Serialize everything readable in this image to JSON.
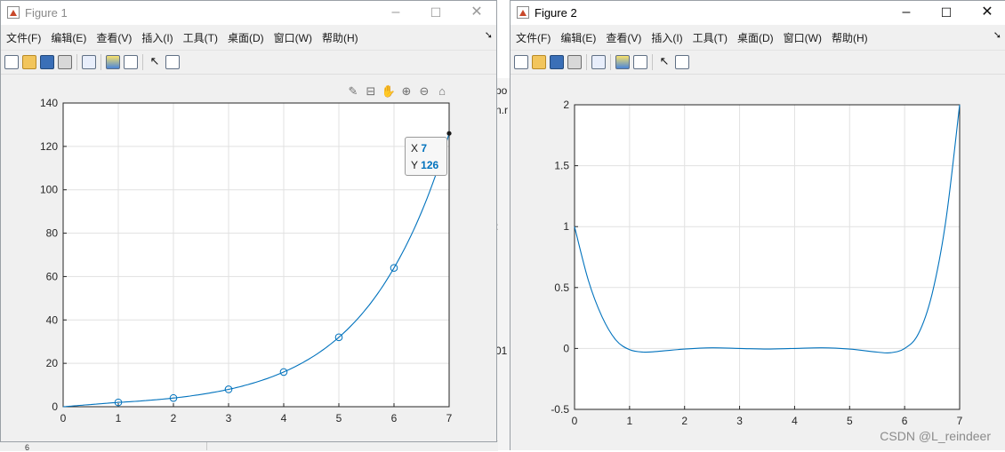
{
  "windows": [
    {
      "title": "Figure 1",
      "menu": [
        "文件(F)",
        "编辑(E)",
        "查看(V)",
        "插入(I)",
        "工具(T)",
        "桌面(D)",
        "窗口(W)",
        "帮助(H)"
      ],
      "controls": [
        "–",
        "☐",
        "✕"
      ],
      "datatip": {
        "x_label": "X",
        "x_value": "7",
        "y_label": "Y",
        "y_value": "126"
      }
    },
    {
      "title": "Figure 2",
      "menu": [
        "文件(F)",
        "编辑(E)",
        "查看(V)",
        "插入(I)",
        "工具(T)",
        "桌面(D)",
        "窗口(W)",
        "帮助(H)"
      ],
      "controls": [
        "–",
        "☐",
        "✕"
      ]
    }
  ],
  "toolbar_icons": [
    "new-figure-icon",
    "open-file-icon",
    "save-icon",
    "print-icon",
    "link-plot-icon",
    "insert-colorbar-icon",
    "insert-legend-icon",
    "edit-plot-pointer-icon",
    "property-inspector-icon"
  ],
  "axes_toolbar_icons": [
    "brush-icon",
    "datatip-icon",
    "pan-icon",
    "zoom-in-icon",
    "zoom-out-icon",
    "home-icon"
  ],
  "background": {
    "fragments": [
      "po",
      "n.r",
      ":",
      "01",
      "6"
    ]
  },
  "watermark": "CSDN @L_reindeer",
  "chart_data": [
    {
      "type": "line",
      "title": "",
      "xlabel": "",
      "ylabel": "",
      "xlim": [
        0,
        7
      ],
      "ylim": [
        0,
        140
      ],
      "xticks": [
        "0",
        "1",
        "2",
        "3",
        "4",
        "5",
        "6",
        "7"
      ],
      "yticks": [
        "0",
        "20",
        "40",
        "60",
        "80",
        "100",
        "120",
        "140"
      ],
      "grid": true,
      "line_color": "#0072bd",
      "series": [
        {
          "x": [
            0,
            1,
            2,
            3,
            4,
            5,
            6,
            7
          ],
          "y": [
            0,
            2,
            4,
            8,
            16,
            32,
            64,
            126
          ],
          "markers": [
            [
              1,
              2
            ],
            [
              2,
              4
            ],
            [
              3,
              8
            ],
            [
              4,
              16
            ],
            [
              5,
              32
            ],
            [
              6,
              64
            ]
          ]
        }
      ],
      "datatip_point": [
        7,
        126
      ]
    },
    {
      "type": "line",
      "title": "",
      "xlabel": "",
      "ylabel": "",
      "xlim": [
        0,
        7
      ],
      "ylim": [
        -0.5,
        2
      ],
      "xticks": [
        "0",
        "1",
        "2",
        "3",
        "4",
        "5",
        "6",
        "7"
      ],
      "yticks": [
        "-0.5",
        "0",
        "0.5",
        "1",
        "1.5",
        "2"
      ],
      "grid": true,
      "line_color": "#0072bd",
      "series": [
        {
          "x": [
            0,
            0.25,
            0.5,
            0.75,
            1,
            1.25,
            1.5,
            2,
            2.5,
            3,
            3.5,
            4,
            4.5,
            5,
            5.5,
            5.75,
            6,
            6.25,
            6.5,
            6.75,
            7
          ],
          "y": [
            1,
            0.56,
            0.26,
            0.07,
            -0.01,
            -0.03,
            -0.025,
            -0.005,
            0.005,
            0,
            -0.005,
            0,
            0.005,
            -0.005,
            -0.03,
            -0.035,
            0,
            0.12,
            0.45,
            1.05,
            2
          ]
        }
      ]
    }
  ]
}
